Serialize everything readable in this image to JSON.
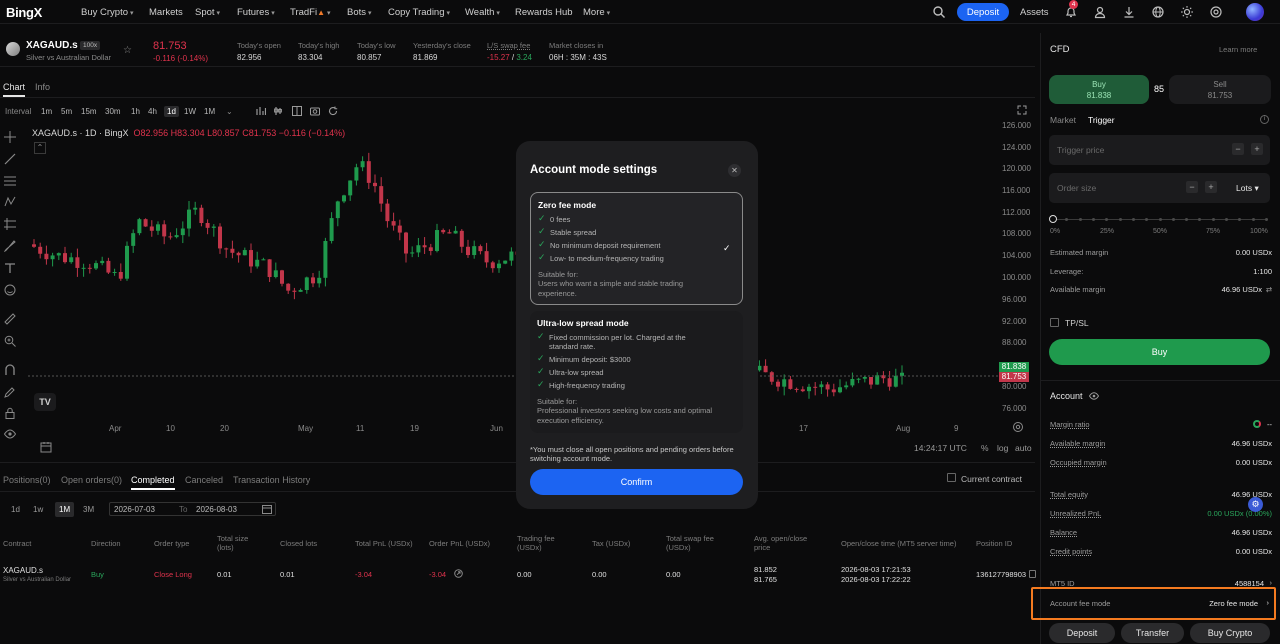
{
  "nav": {
    "logo": "BingX",
    "items": [
      "Buy Crypto",
      "Markets",
      "Spot",
      "Futures",
      "TradFi",
      "Bots",
      "Copy Trading",
      "Wealth",
      "Rewards Hub",
      "More"
    ],
    "deposit": "Deposit",
    "assets": "Assets",
    "notification_count": "4"
  },
  "ticker": {
    "symbol": "XAGAUD.s",
    "leverage": "100x",
    "name": "Silver vs Australian Dollar",
    "price": "81.753",
    "change": "-0.116 (-0.14%)",
    "stats": [
      {
        "label": "Today's open",
        "value": "82.956"
      },
      {
        "label": "Today's high",
        "value": "83.304"
      },
      {
        "label": "Today's low",
        "value": "80.857"
      },
      {
        "label": "Yesterday's close",
        "value": "81.869"
      },
      {
        "label": "L/S swap fee",
        "value_a": "-15.27",
        "value_b": "3.24"
      },
      {
        "label": "Market closes in",
        "value": "06H : 35M : 43S"
      }
    ]
  },
  "chart_tabs": {
    "chart": "Chart",
    "info": "Info"
  },
  "timeframes": [
    "Interval",
    "1m",
    "5m",
    "15m",
    "30m",
    "1h",
    "4h",
    "1d",
    "1W",
    "1M"
  ],
  "legend": {
    "title": "XAGAUD.s · 1D · BingX",
    "o": "O82.956",
    "h": "H83.304",
    "l": "L80.857",
    "c": "C81.753",
    "chg": "−0.116 (−0.14%)"
  },
  "chart_data": {
    "type": "candlestick",
    "title": "XAGAUD.s · 1D · BingX",
    "y_ticks": [
      "126.000",
      "124.000",
      "120.000",
      "116.000",
      "112.000",
      "108.000",
      "104.000",
      "100.000",
      "96.000",
      "92.000",
      "88.000",
      "84.000",
      "80.000",
      "76.000"
    ],
    "x_ticks": [
      "Apr",
      "10",
      "20",
      "May",
      "11",
      "19",
      "Jun",
      "17",
      "Aug",
      "9"
    ],
    "price_labels": {
      "buy": "81.838",
      "sell": "81.753"
    },
    "time": "14:24:17 UTC",
    "scale_opts": [
      "%",
      "log",
      "auto"
    ],
    "colors": {
      "up": "#1f9a4d",
      "down": "#c2364a"
    }
  },
  "orders": {
    "tabs": [
      "Positions(0)",
      "Open orders(0)",
      "Completed",
      "Canceled",
      "Transaction History"
    ],
    "current_contract": "Current contract",
    "periods": [
      "1d",
      "1w",
      "1M",
      "3M"
    ],
    "date_from": "2026-07-03",
    "date_to": "2026-08-03",
    "to_label": "To",
    "headers": [
      "Contract",
      "Direction",
      "Order type",
      "Total size (lots)",
      "Closed lots",
      "Total PnL (USDx)",
      "Order PnL (USDx)",
      "Trading fee (USDx)",
      "Tax (USDx)",
      "Total swap fee (USDx)",
      "Avg. open/close price",
      "Open/close time (MT5 server time)",
      "Position ID"
    ],
    "row": {
      "contract": "XAGAUD.s",
      "contract_sub": "Silver vs Australian Dollar",
      "direction": "Buy",
      "order_type": "Close Long",
      "total_size": "0.01",
      "closed_lots": "0.01",
      "total_pnl": "-3.04",
      "order_pnl": "-3.04",
      "fee": "0.00",
      "tax": "0.00",
      "swap": "0.00",
      "open_price": "81.852",
      "close_price": "81.765",
      "open_time": "2026-08-03 17:21:53",
      "close_time": "2026-08-03 17:22:22",
      "position_id": "136127798903"
    }
  },
  "modal": {
    "title": "Account mode settings",
    "zero": {
      "title": "Zero fee mode",
      "features": [
        "0 fees",
        "Stable spread",
        "No minimum deposit requirement",
        "Low- to medium-frequency trading"
      ],
      "suitable_label": "Suitable for:",
      "suitable": "Users who want a simple and stable trading experience."
    },
    "ultra": {
      "title": "Ultra-low spread mode",
      "features": [
        "Fixed commission per lot. Charged at the standard rate.",
        "Minimum deposit: $3000",
        "Ultra-low spread",
        "High-frequency trading"
      ],
      "suitable_label": "Suitable for:",
      "suitable": "Professional investors seeking low costs and optimal execution efficiency."
    },
    "note": "*You must close all open positions and pending orders before switching account mode.",
    "confirm": "Confirm"
  },
  "panel": {
    "title": "CFD",
    "learn_more": "Learn more",
    "buy_label": "Buy",
    "buy_price": "81.838",
    "spread": "85",
    "sell_label": "Sell",
    "sell_price": "81.753",
    "market": "Market",
    "trigger": "Trigger",
    "trigger_price": "Trigger price",
    "order_size": "Order size",
    "lots": "Lots",
    "slider_marks": [
      "0%",
      "25%",
      "50%",
      "75%",
      "100%"
    ],
    "slider_value": 0,
    "est_margin_label": "Estimated margin",
    "est_margin": "0.00 USDx",
    "leverage_label": "Leverage:",
    "leverage": "1:100",
    "avail_margin_label": "Available margin",
    "avail_margin": "46.96 USDx",
    "tpsl": "TP/SL",
    "buy_button": "Buy"
  },
  "account": {
    "title": "Account",
    "rows": [
      {
        "label": "Margin ratio",
        "value": "--"
      },
      {
        "label": "Available margin",
        "value": "46.96 USDx"
      },
      {
        "label": "Occupied margin",
        "value": "0.00 USDx"
      },
      {
        "label": "Total equity",
        "value": "46.96 USDx"
      },
      {
        "label": "Unrealized PnL",
        "value": "0.00 USDx (0.00%)"
      },
      {
        "label": "Balance",
        "value": "46.96 USDx"
      },
      {
        "label": "Credit points",
        "value": "0.00 USDx"
      },
      {
        "label": "MT5 ID",
        "value": "4588154"
      }
    ],
    "fee_mode_label": "Account fee mode",
    "fee_mode": "Zero fee mode",
    "buttons": [
      "Deposit",
      "Transfer",
      "Buy Crypto"
    ]
  }
}
